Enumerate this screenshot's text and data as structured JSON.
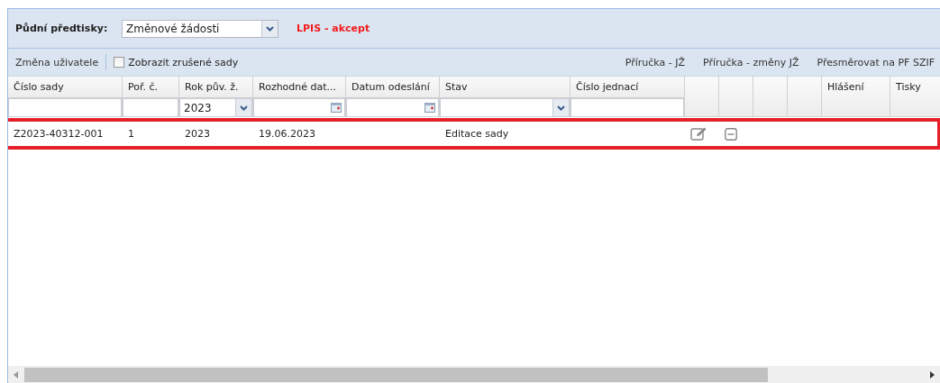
{
  "top_bar": {
    "label": "Půdní předtisky:",
    "select": {
      "value": "Změnové žádosti"
    },
    "environment": "LPIS - akcept"
  },
  "toolbar": {
    "user_change": "Změna uživatele",
    "show_cancelled": {
      "label": "Zobrazit zrušené sady",
      "checked": false
    },
    "links": [
      "Příručka - JŽ",
      "Příručka - změny JŽ",
      "Přesměrovat na PF SZIF"
    ]
  },
  "table": {
    "columns": [
      {
        "label": "Číslo sady",
        "filter": {
          "kind": "text"
        }
      },
      {
        "label": "Poř. č.",
        "filter": {
          "kind": "text"
        }
      },
      {
        "label": "Rok pův. ž.",
        "filter": {
          "kind": "select",
          "value": "2023"
        }
      },
      {
        "label": "Rozhodné dat...",
        "filter": {
          "kind": "date"
        }
      },
      {
        "label": "Datum odeslání",
        "filter": {
          "kind": "date"
        }
      },
      {
        "label": "Stav",
        "filter": {
          "kind": "select"
        }
      },
      {
        "label": "Číslo jednací",
        "filter": {
          "kind": "text"
        }
      },
      {},
      {},
      {},
      {},
      {
        "label": "Hlášení"
      },
      {
        "label": "Tisky"
      }
    ],
    "rows": [
      {
        "highlighted": true,
        "cells": [
          {
            "kind": "text",
            "text": "Z2023-40312-001"
          },
          {
            "kind": "text",
            "text": "1"
          },
          {
            "kind": "text",
            "text": "2023"
          },
          {
            "kind": "text",
            "text": "19.06.2023"
          },
          {
            "kind": "blank"
          },
          {
            "kind": "text",
            "text": "Editace sady"
          },
          {
            "kind": "blank"
          },
          {
            "kind": "edit"
          },
          {
            "kind": "remove"
          },
          {
            "kind": "blank"
          },
          {
            "kind": "blank"
          },
          {
            "kind": "blank"
          },
          {
            "kind": "blank"
          }
        ]
      }
    ]
  }
}
